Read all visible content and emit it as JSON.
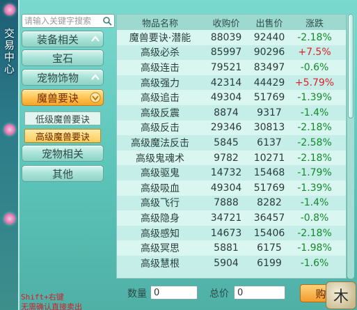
{
  "sidebar": {
    "title": "交易中心"
  },
  "search": {
    "placeholder": "请输入关键字搜索"
  },
  "menu": {
    "categories": [
      {
        "label": "装备相关",
        "expanded": true
      },
      {
        "label": "宝石"
      },
      {
        "label": "宠物饰物",
        "expanded": true
      },
      {
        "label": "魔兽要诀",
        "expanded": true,
        "active": true
      },
      {
        "label": "宠物相关"
      },
      {
        "label": "其他"
      }
    ],
    "subitems": [
      {
        "label": "低级魔兽要诀"
      },
      {
        "label": "高级魔兽要诀",
        "active": true
      }
    ]
  },
  "table": {
    "headers": [
      "物品名称",
      "收购价",
      "出售价",
      "涨跌"
    ],
    "rows": [
      {
        "name": "魔兽要诀·潜能",
        "buy": "88039",
        "sell": "92440",
        "change": "-2.18%",
        "dir": "down"
      },
      {
        "name": "高级必杀",
        "buy": "85997",
        "sell": "90296",
        "change": "+7.5%",
        "dir": "up"
      },
      {
        "name": "高级连击",
        "buy": "79521",
        "sell": "83497",
        "change": "-0.6%",
        "dir": "down"
      },
      {
        "name": "高级强力",
        "buy": "42314",
        "sell": "44429",
        "change": "+5.79%",
        "dir": "up"
      },
      {
        "name": "高级追击",
        "buy": "49304",
        "sell": "51769",
        "change": "-1.39%",
        "dir": "down"
      },
      {
        "name": "高级反震",
        "buy": "8874",
        "sell": "9317",
        "change": "-1.4%",
        "dir": "down"
      },
      {
        "name": "高级反击",
        "buy": "29346",
        "sell": "30813",
        "change": "-2.18%",
        "dir": "down"
      },
      {
        "name": "高级魔法反击",
        "buy": "5845",
        "sell": "6137",
        "change": "-2.58%",
        "dir": "down"
      },
      {
        "name": "高级鬼魂术",
        "buy": "9782",
        "sell": "10271",
        "change": "-2.18%",
        "dir": "down"
      },
      {
        "name": "高级驱鬼",
        "buy": "14732",
        "sell": "15468",
        "change": "-1.79%",
        "dir": "down"
      },
      {
        "name": "高级吸血",
        "buy": "49304",
        "sell": "51769",
        "change": "-1.39%",
        "dir": "down"
      },
      {
        "name": "高级飞行",
        "buy": "7888",
        "sell": "8282",
        "change": "-1.4%",
        "dir": "down"
      },
      {
        "name": "高级隐身",
        "buy": "34721",
        "sell": "36457",
        "change": "-0.8%",
        "dir": "down"
      },
      {
        "name": "高级感知",
        "buy": "14673",
        "sell": "15406",
        "change": "-2.18%",
        "dir": "down"
      },
      {
        "name": "高级冥思",
        "buy": "5881",
        "sell": "6175",
        "change": "-1.98%",
        "dir": "down"
      },
      {
        "name": "高级慧根",
        "buy": "5904",
        "sell": "6199",
        "change": "-1.6%",
        "dir": "down"
      }
    ]
  },
  "bottom": {
    "quantity_label": "数量",
    "quantity_value": "0",
    "total_label": "总价",
    "total_value": "0",
    "buy_label": "购",
    "hint_line1": "Shift+右键",
    "hint_line2": "无需确认直接卖出",
    "badge_text": "木"
  },
  "colors": {
    "down": "#138a2a",
    "up": "#e0202a",
    "accent": "#f3a52a"
  }
}
